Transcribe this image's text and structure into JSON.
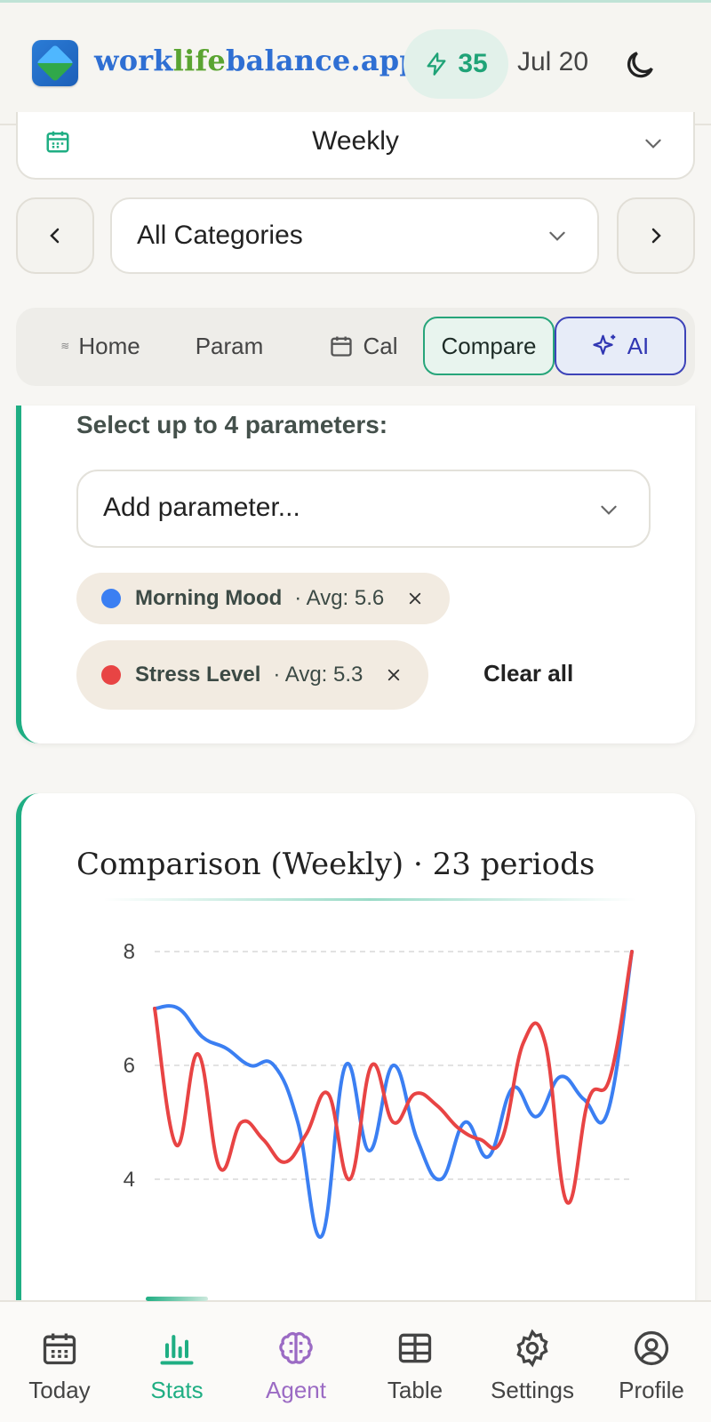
{
  "header": {
    "brand_part1": "work",
    "brand_part2": "life",
    "brand_part3": "balance.app",
    "streak_count": "35",
    "date": "Jul 20"
  },
  "period_select": {
    "value": "Weekly"
  },
  "category_select": {
    "value": "All Categories"
  },
  "tabs": [
    {
      "label": "Home"
    },
    {
      "label": "Param"
    },
    {
      "label": "Cal"
    },
    {
      "label": "Compare"
    },
    {
      "label": "AI"
    }
  ],
  "parameters": {
    "label": "Select up to 4 parameters:",
    "add_placeholder": "Add parameter...",
    "chips": [
      {
        "name": "Morning Mood",
        "avg": "· Avg: 5.6",
        "color": "#3b7ff2"
      },
      {
        "name": "Stress Level",
        "avg": "· Avg: 5.3",
        "color": "#e84444"
      }
    ],
    "clear_all": "Clear all"
  },
  "chart": {
    "title": "Comparison (Weekly) · 23 periods"
  },
  "chart_data": {
    "type": "line",
    "x": [
      1,
      2,
      3,
      4,
      5,
      6,
      7,
      8,
      9,
      10,
      11,
      12,
      13,
      14,
      15,
      16,
      17,
      18,
      19,
      20,
      21,
      22,
      23
    ],
    "ylim": [
      3,
      8
    ],
    "yticks": [
      "4",
      "6",
      "8"
    ],
    "grid": true,
    "series": [
      {
        "name": "Morning Mood",
        "color": "#3b7ff2",
        "values": [
          7.0,
          7.0,
          6.5,
          6.3,
          6.0,
          6.0,
          5.0,
          3.0,
          6.0,
          4.5,
          6.0,
          4.7,
          4.0,
          5.0,
          4.4,
          5.6,
          5.1,
          5.8,
          5.4,
          5.2,
          8.0,
          null,
          null
        ]
      },
      {
        "name": "Stress Level",
        "color": "#e84444",
        "values": [
          7.0,
          4.6,
          6.2,
          4.2,
          5.0,
          4.7,
          4.3,
          4.8,
          5.5,
          4.0,
          6.0,
          5.0,
          5.5,
          5.3,
          4.9,
          4.7,
          4.7,
          6.4,
          6.4,
          3.6,
          5.4,
          5.8,
          8.0
        ]
      }
    ]
  },
  "bottom_nav": [
    {
      "label": "Today"
    },
    {
      "label": "Stats"
    },
    {
      "label": "Agent"
    },
    {
      "label": "Table"
    },
    {
      "label": "Settings"
    },
    {
      "label": "Profile"
    }
  ]
}
